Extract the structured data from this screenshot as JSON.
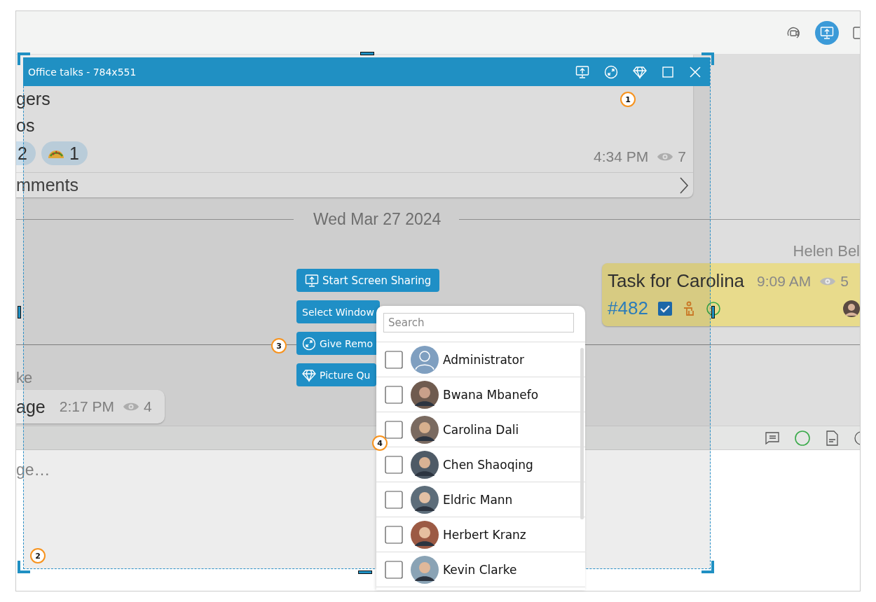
{
  "top_message": {
    "lines": [
      "gers",
      "os"
    ],
    "reactions": [
      {
        "kind": "cut",
        "count": "2"
      },
      {
        "kind": "emoji",
        "count": "1"
      }
    ],
    "time": "4:34 PM",
    "views": "7",
    "comments": "mments"
  },
  "date_divider": "Wed Mar 27 2024",
  "task_message": {
    "sender": "Helen Bel",
    "title": "Task for Carolina",
    "time": "9:09 AM",
    "views": "5",
    "task_number": "#482",
    "done": true
  },
  "message": {
    "sender": "ke",
    "text": "age",
    "time": "2:17 PM",
    "views": "4"
  },
  "composer": {
    "placeholder": "ge…"
  },
  "capture_window": {
    "title": "Office talks - 784x551"
  },
  "markers": [
    "1",
    "2",
    "3",
    "4"
  ],
  "share_buttons": [
    {
      "label": "Start Screen Sharing",
      "kind": "screen"
    },
    {
      "label": "Select Window",
      "kind": "plain"
    },
    {
      "label": "Give Remo",
      "kind": "remote"
    },
    {
      "label": "Picture Qu",
      "kind": "quality"
    }
  ],
  "user_picker": {
    "search": {
      "placeholder": "Search"
    },
    "users": [
      {
        "name": "Administrator",
        "checked": false,
        "kind": "default"
      },
      {
        "name": "Bwana Mbanefo",
        "checked": false
      },
      {
        "name": "Carolina Dali",
        "checked": false
      },
      {
        "name": "Chen Shaoqing",
        "checked": false
      },
      {
        "name": "Eldric Mann",
        "checked": false
      },
      {
        "name": "Herbert Kranz",
        "checked": false
      },
      {
        "name": "Kevin Clarke",
        "checked": false
      }
    ]
  }
}
